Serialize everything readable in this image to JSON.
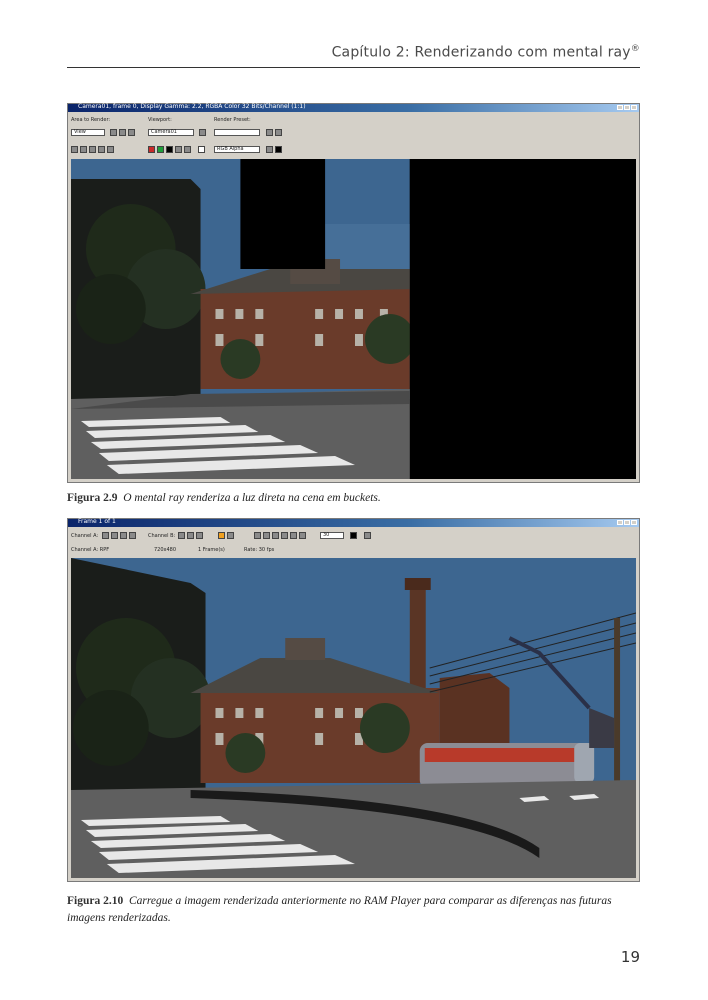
{
  "header": {
    "running_head": "Capítulo 2: Renderizando com mental ray",
    "reg_mark": "®"
  },
  "figure_1": {
    "caption_label": "Figura 2.9",
    "caption_text": "O mental ray renderiza a luz direta na cena em buckets.",
    "window_title": "Camera01, frame 0, Display Gamma: 2.2, RGBA Color 32 Bits/Channel (1:1)",
    "area_label": "Area to Render:",
    "area_value": "View",
    "viewport_label": "Viewport:",
    "viewport_value": "Camera01",
    "preset_label": "Render Preset:",
    "preset_value": "",
    "channel_value": "RGB Alpha"
  },
  "figure_2": {
    "caption_label": "Figura 2.10",
    "caption_text": "Carregue a imagem renderizada anteriormente no RAM Player para comparar as diferenças nas futuras imagens renderizadas.",
    "window_title": "Frame 1 of 1",
    "channel_a_label": "Channel A:",
    "channel_b_label": "Channel B:",
    "channel_a_sub": "Channel A: RPF",
    "size_text": "720x480",
    "frame_text": "1 Frame(s)",
    "rate_text": "Rate: 30 fps",
    "frame_value": "30"
  },
  "page": {
    "number": "19"
  }
}
